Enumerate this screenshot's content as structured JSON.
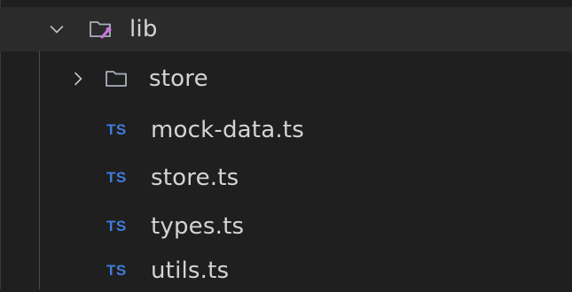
{
  "explorer": {
    "folder": {
      "name": "lib",
      "expanded": true,
      "chevron_icon": "chevron-down-icon",
      "icon": "folder-lib-icon",
      "accent_color": "#c978e0"
    },
    "children": [
      {
        "type": "folder",
        "name": "store",
        "expanded": false,
        "chevron_icon": "chevron-right-icon",
        "icon": "folder-icon"
      },
      {
        "type": "file",
        "name": "mock-data.ts",
        "badge": "TS",
        "icon": "typescript-file-icon"
      },
      {
        "type": "file",
        "name": "store.ts",
        "badge": "TS",
        "icon": "typescript-file-icon"
      },
      {
        "type": "file",
        "name": "types.ts",
        "badge": "TS",
        "icon": "typescript-file-icon"
      },
      {
        "type": "file",
        "name": "utils.ts",
        "badge": "TS",
        "icon": "typescript-file-icon"
      }
    ],
    "colors": {
      "background": "#1f1f1f",
      "selected_row": "#2b2b2b",
      "text": "#d4d4d4",
      "ts_badge": "#3f7ddc"
    }
  }
}
